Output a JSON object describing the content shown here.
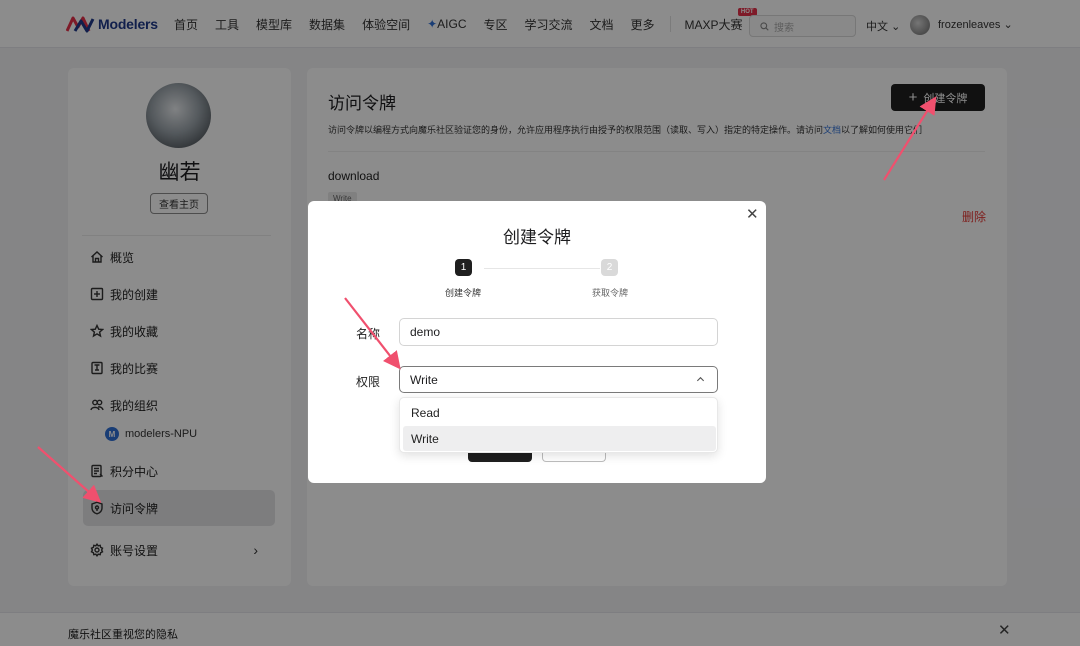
{
  "brand": {
    "logo_text": "Modelers",
    "accent": "#1f1f1f",
    "brand_blue": "#1f3a8a",
    "danger": "#e53935"
  },
  "nav": {
    "items": [
      "首页",
      "工具",
      "模型库",
      "数据集",
      "体验空间",
      "AIGC",
      "专区",
      "学习交流",
      "文档",
      "更多"
    ],
    "maxp_label": "MAXP大赛",
    "hot_badge": "HOT",
    "search_placeholder": "搜索",
    "language": "中文",
    "username": "frozenleaves"
  },
  "sidebar": {
    "profile_name": "幽若",
    "view_home": "查看主页",
    "items": [
      {
        "label": "概览",
        "icon": "home-icon"
      },
      {
        "label": "我的创建",
        "icon": "plus-square-icon"
      },
      {
        "label": "我的收藏",
        "icon": "star-icon"
      },
      {
        "label": "我的比赛",
        "icon": "trophy-icon"
      },
      {
        "label": "我的组织",
        "icon": "users-icon"
      },
      {
        "label": "积分中心",
        "icon": "points-icon"
      },
      {
        "label": "访问令牌",
        "icon": "shield-icon",
        "active": true
      },
      {
        "label": "账号设置",
        "icon": "gear-icon"
      }
    ],
    "org_badge": "M",
    "org_name": "modelers-NPU"
  },
  "main": {
    "title": "访问令牌",
    "description_before": "访问令牌以编程方式向魔乐社区验证您的身份，允许应用程序执行由授予的权限范围（读取、写入）指定的特定操作。请访问",
    "description_link": "文档",
    "description_after": "以了解如何使用它们",
    "create_button": "创建令牌",
    "tokens": [
      {
        "name": "download",
        "permission": "Write",
        "delete_label": "删除"
      }
    ]
  },
  "modal": {
    "title": "创建令牌",
    "steps": [
      {
        "number": "1",
        "label": "创建令牌"
      },
      {
        "number": "2",
        "label": "获取令牌"
      }
    ],
    "name_label": "名称",
    "name_value": "demo",
    "permission_label": "权限",
    "permission_value": "Write",
    "permission_options": [
      "Read",
      "Write"
    ]
  },
  "cookie": {
    "text": "魔乐社区重视您的隐私"
  }
}
